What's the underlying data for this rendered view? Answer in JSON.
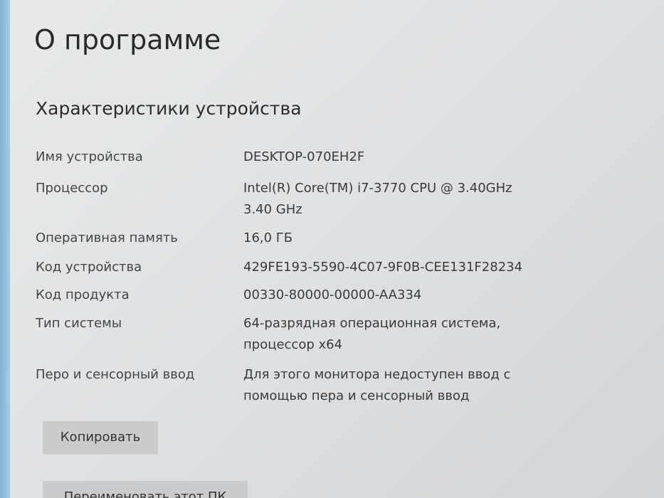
{
  "page": {
    "title": "О программе",
    "section_title": "Характеристики устройства"
  },
  "specs": [
    {
      "label": "Имя устройства",
      "value": "DESKTOP-070EH2F"
    },
    {
      "label": "Процессор",
      "value": "Intel(R) Core(TM) i7-3770 CPU @ 3.40GHz\n3.40 GHz"
    },
    {
      "label": "Оперативная память",
      "value": "16,0 ГБ"
    },
    {
      "label": "Код устройства",
      "value": "429FE193-5590-4C07-9F0B-CEE131F28234"
    },
    {
      "label": "Код продукта",
      "value": "00330-80000-00000-AA334"
    },
    {
      "label": "Тип системы",
      "value": "64-разрядная операционная система,\nпроцессор x64"
    },
    {
      "label": "Перо и сенсорный ввод",
      "value": "Для этого монитора недоступен ввод с\nпомощью пера и сенсорный ввод"
    }
  ],
  "buttons": {
    "copy_label": "Копировать",
    "rename_label": "Переименовать этот ПК"
  }
}
